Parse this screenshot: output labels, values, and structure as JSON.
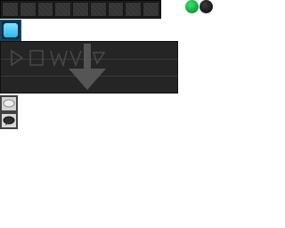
{
  "slots": [
    {
      "id": "slot-1"
    },
    {
      "id": "slot-2"
    },
    {
      "id": "slot-3"
    },
    {
      "id": "slot-4"
    },
    {
      "id": "slot-5"
    },
    {
      "id": "slot-6"
    },
    {
      "id": "slot-7"
    },
    {
      "id": "slot-8"
    },
    {
      "id": "slot-9"
    }
  ],
  "indicators": {
    "active_color": "#17a840",
    "inactive_color": "#1b1b1b"
  },
  "panel": {
    "watermark_text": "WAVE",
    "icons": [
      "play-icon",
      "stop-icon",
      "wave-icon",
      "cursor-icon",
      "download-arrow-icon"
    ]
  },
  "palette": {
    "items": [
      {
        "name": "light-bubble-icon"
      },
      {
        "name": "dark-bubble-icon"
      }
    ]
  },
  "colors": {
    "accent_cyan": "#2cb9ec",
    "panel_bg": "#252525"
  }
}
